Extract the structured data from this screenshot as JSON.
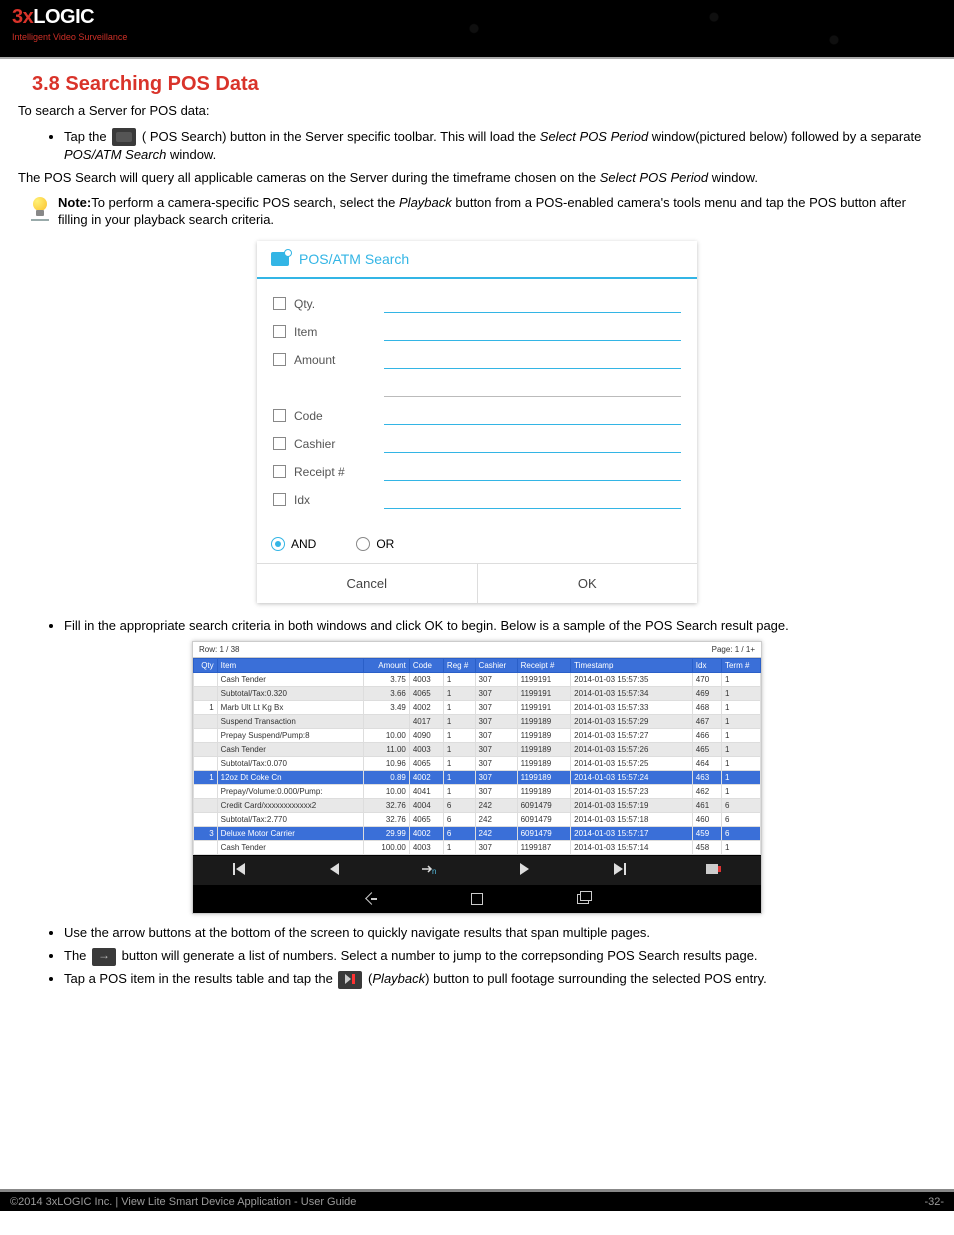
{
  "brand": {
    "prefix": "3x",
    "suffix": "LOGIC",
    "tagline": "Intelligent Video Surveillance"
  },
  "heading": "3.8 Searching POS Data",
  "intro": "To search a Server for POS data:",
  "step1": {
    "pre": "Tap the ",
    "icon_name": "pos-search-icon",
    "mid": " ( POS Search) button in the Server specific toolbar. This will load the ",
    "em1": "Select POS Period",
    "mid2": " window(pictured below) followed by a separate ",
    "em2": "POS/ATM Search",
    "post": " window."
  },
  "para2": {
    "pre": "The POS Search will query all applicable cameras on the Server during the timeframe chosen on the ",
    "em": "Select POS Period",
    "post": " window."
  },
  "note": {
    "label": "Note:",
    "pre": "To perform a camera-specific POS search, select the ",
    "em": "Playback",
    "post": " button from a POS-enabled camera's tools menu and tap the POS button after filling in your playback search criteria."
  },
  "search_card": {
    "title": "POS/ATM Search",
    "fields": [
      {
        "label": "Qty.",
        "underline": "blue"
      },
      {
        "label": "Item",
        "underline": "blue"
      },
      {
        "label": "Amount",
        "underline": "blue"
      },
      {
        "label": "",
        "underline": "grey"
      },
      {
        "label": "Code",
        "underline": "blue"
      },
      {
        "label": "Cashier",
        "underline": "blue"
      },
      {
        "label": "Receipt #",
        "underline": "blue"
      },
      {
        "label": "Idx",
        "underline": "blue"
      }
    ],
    "radio": {
      "and": "AND",
      "or": "OR",
      "selected": "AND"
    },
    "cancel": "Cancel",
    "ok": "OK"
  },
  "step2": "Fill in the appropriate search criteria in both windows and click OK to begin. Below is a sample of the POS Search result page.",
  "results": {
    "row_label": "Row: 1 / 38",
    "page_label": "Page: 1 / 1+",
    "headers": [
      "Qty",
      "Item",
      "Amount",
      "Code",
      "Reg #",
      "Cashier",
      "Receipt #",
      "Timestamp",
      "Idx",
      "Term #"
    ],
    "rows": [
      {
        "alt": false,
        "cells": [
          "",
          "Cash Tender",
          "3.75",
          "4003",
          "1",
          "307",
          "1199191",
          "2014-01-03 15:57:35",
          "470",
          "1"
        ]
      },
      {
        "alt": true,
        "cells": [
          "",
          "Subtotal/Tax:0.320",
          "3.66",
          "4065",
          "1",
          "307",
          "1199191",
          "2014-01-03 15:57:34",
          "469",
          "1"
        ]
      },
      {
        "alt": false,
        "cells": [
          "1",
          "Marb Ult Lt Kg Bx",
          "3.49",
          "4002",
          "1",
          "307",
          "1199191",
          "2014-01-03 15:57:33",
          "468",
          "1"
        ]
      },
      {
        "alt": true,
        "cells": [
          "",
          "Suspend Transaction",
          "",
          "4017",
          "1",
          "307",
          "1199189",
          "2014-01-03 15:57:29",
          "467",
          "1"
        ]
      },
      {
        "alt": false,
        "cells": [
          "",
          "Prepay Suspend/Pump:8",
          "10.00",
          "4090",
          "1",
          "307",
          "1199189",
          "2014-01-03 15:57:27",
          "466",
          "1"
        ]
      },
      {
        "alt": true,
        "cells": [
          "",
          "Cash Tender",
          "11.00",
          "4003",
          "1",
          "307",
          "1199189",
          "2014-01-03 15:57:26",
          "465",
          "1"
        ]
      },
      {
        "alt": false,
        "cells": [
          "",
          "Subtotal/Tax:0.070",
          "10.96",
          "4065",
          "1",
          "307",
          "1199189",
          "2014-01-03 15:57:25",
          "464",
          "1"
        ]
      },
      {
        "alt": false,
        "sel": true,
        "cells": [
          "1",
          "12oz Dt Coke Cn",
          "0.89",
          "4002",
          "1",
          "307",
          "1199189",
          "2014-01-03 15:57:24",
          "463",
          "1"
        ]
      },
      {
        "alt": false,
        "cells": [
          "",
          "Prepay/Volume:0.000/Pump:",
          "10.00",
          "4041",
          "1",
          "307",
          "1199189",
          "2014-01-03 15:57:23",
          "462",
          "1"
        ]
      },
      {
        "alt": true,
        "cells": [
          "",
          "Credit Card/xxxxxxxxxxxx2",
          "32.76",
          "4004",
          "6",
          "242",
          "6091479",
          "2014-01-03 15:57:19",
          "461",
          "6"
        ]
      },
      {
        "alt": false,
        "cells": [
          "",
          "Subtotal/Tax:2.770",
          "32.76",
          "4065",
          "6",
          "242",
          "6091479",
          "2014-01-03 15:57:18",
          "460",
          "6"
        ]
      },
      {
        "alt": true,
        "sel": true,
        "cells": [
          "3",
          "Deluxe Motor Carrier",
          "29.99",
          "4002",
          "6",
          "242",
          "6091479",
          "2014-01-03 15:57:17",
          "459",
          "6"
        ]
      },
      {
        "alt": false,
        "cells": [
          "",
          "Cash Tender",
          "100.00",
          "4003",
          "1",
          "307",
          "1199187",
          "2014-01-03 15:57:14",
          "458",
          "1"
        ]
      }
    ]
  },
  "step3": "Use the arrow buttons at the bottom of the screen to quickly navigate results that span multiple pages.",
  "step4": {
    "pre": "The ",
    "icon_name": "goto-page-icon",
    "post": " button will generate a list of numbers. Select a number to jump to the correpsonding POS Search results page."
  },
  "step5": {
    "pre": "Tap a POS item in the results table and tap the ",
    "icon_name": "playback-icon",
    "mid": " (",
    "em": "Playback",
    "post": ") button to pull footage surrounding the selected POS entry."
  },
  "footer": {
    "left": "©2014 3xLOGIC Inc. | View Lite Smart Device Application - User Guide",
    "right": "-32-"
  }
}
